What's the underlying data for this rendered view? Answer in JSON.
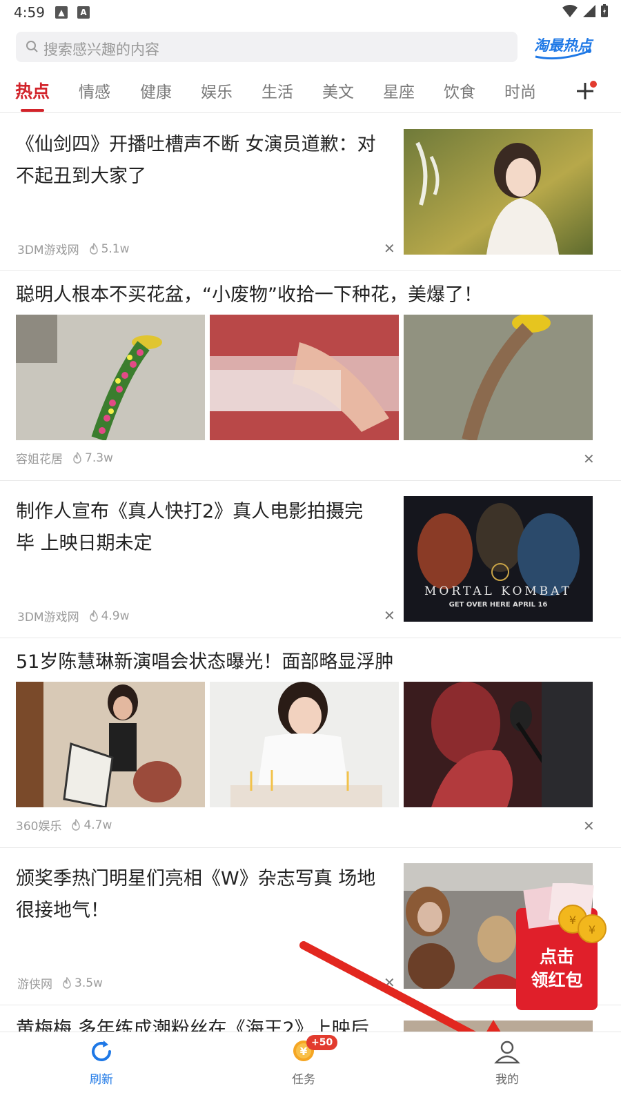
{
  "status_bar": {
    "time": "4:59"
  },
  "search": {
    "placeholder": "搜索感兴趣的内容"
  },
  "brand": {
    "logo_text": "淘最热点"
  },
  "tabs": [
    "热点",
    "情感",
    "健康",
    "娱乐",
    "生活",
    "美文",
    "星座",
    "饮食",
    "时尚"
  ],
  "active_tab": "热点",
  "articles": [
    {
      "title": "《仙剑四》开播吐槽声不断 女演员道歉：对不起丑到大家了",
      "title_line1": "《仙剑四》开播吐槽声不断 女演员道歉：对",
      "title_line2": "不起丑到大家了",
      "source": "3DM游戏网",
      "heat": "5.1w",
      "image": "costume-drama-actress"
    },
    {
      "title": "聪明人根本不买花盆，“小废物”收拾一下种花，美爆了！",
      "source": "容姐花居",
      "heat": "7.3w",
      "images": [
        "flower-wall-planter",
        "hand-plastic-bottle",
        "bamboo-flower-pipe"
      ]
    },
    {
      "title": "制作人宣布《真人快打2》真人电影拍摄完毕 上映日期未定",
      "title_line1": "制作人宣布《真人快打2》真人电影拍摄完",
      "title_line2": "毕 上映日期未定",
      "source": "3DM游戏网",
      "heat": "4.9w",
      "image": "mortal-kombat-poster",
      "poster_title": "MORTAL KOMBAT",
      "poster_tagline": "GET OVER HERE APRIL 16"
    },
    {
      "title": "51岁陈慧琳新演唱会状态曝光！面部略显浮肿",
      "source": "360娱乐",
      "heat": "4.7w",
      "images": [
        "woman-with-bags",
        "birthday-cake-girl",
        "singer-with-microphone"
      ]
    },
    {
      "title": "颁奖季热门明星们亮相《W》杂志写真 场地很接地气！",
      "title_line1": "颁奖季热门明星们亮相《W》杂志写真 场地",
      "title_line2": "很接地气！",
      "source": "游侠网",
      "heat": "3.5w",
      "image": "wig-shop-photo"
    },
    {
      "title_partial": "黄梅梅 多年练成潮粉丝在《海王2》上映后",
      "image": "partial-thumbnail"
    }
  ],
  "red_packet": {
    "line1": "点击",
    "line2": "领红包"
  },
  "bottom_nav": {
    "items": [
      {
        "label": "刷新",
        "icon": "refresh-icon"
      },
      {
        "label": "任务",
        "icon": "coin-task-icon",
        "badge": "+50"
      },
      {
        "label": "我的",
        "icon": "user-icon"
      }
    ]
  },
  "colors": {
    "accent_red": "#d2232a",
    "nav_blue": "#1e78e6",
    "text_gray": "#9b9b9b"
  }
}
